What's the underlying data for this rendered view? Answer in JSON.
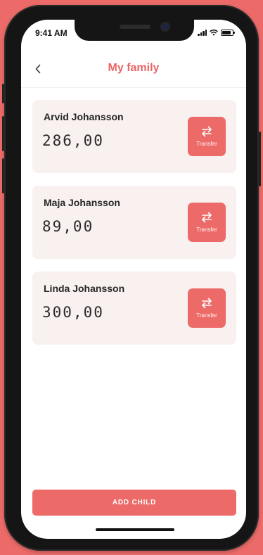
{
  "colors": {
    "accent": "#ec6b69",
    "title": "#e86765",
    "card_bg": "#f9f0f0"
  },
  "status_bar": {
    "time": "9:41 AM",
    "icons": [
      "signal-icon",
      "wifi-icon",
      "battery-icon"
    ]
  },
  "header": {
    "back_icon": "chevron-left-icon",
    "title": "My family"
  },
  "children": [
    {
      "name": "Arvid Johansson",
      "balance": "286,00",
      "action_label": "Transfer",
      "action_icon": "transfer-arrows-icon"
    },
    {
      "name": "Maja Johansson",
      "balance": "89,00",
      "action_label": "Transfer",
      "action_icon": "transfer-arrows-icon"
    },
    {
      "name": "Linda Johansson",
      "balance": "300,00",
      "action_label": "Transfer",
      "action_icon": "transfer-arrows-icon"
    }
  ],
  "footer": {
    "add_child_label": "ADD CHILD"
  }
}
